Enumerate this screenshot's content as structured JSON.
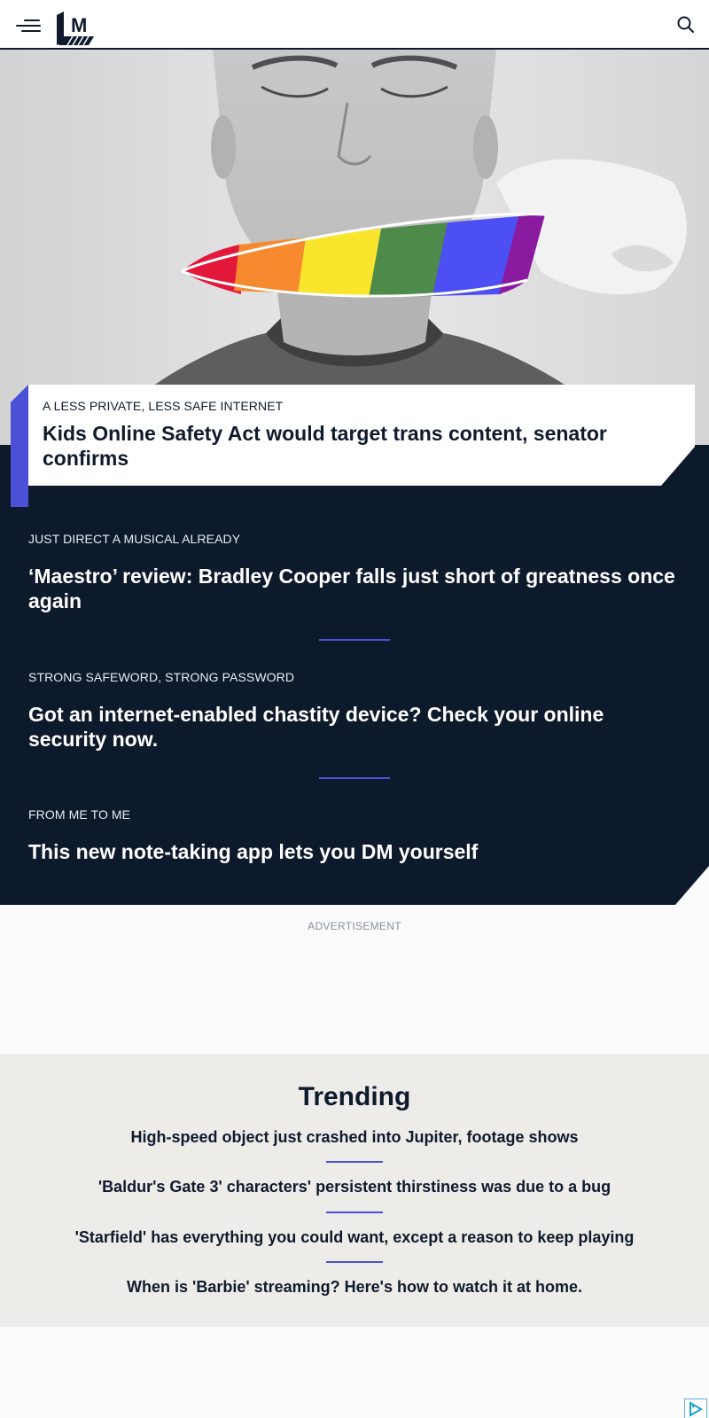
{
  "header": {
    "menu_icon": "hamburger-menu-icon",
    "logo_letter": "M",
    "search_icon": "search-icon"
  },
  "hero": {
    "image_alt": "Illustration of a young man with closed eyes; a torn rainbow paper strip covers his mouth",
    "kicker": "A LESS PRIVATE, LESS SAFE INTERNET",
    "title": "Kids Online Safety Act would target trans content, senator confirms"
  },
  "stories": [
    {
      "kicker": "JUST DIRECT A MUSICAL ALREADY",
      "title": "‘Maestro’ review: Bradley Cooper falls just short of greatness once again"
    },
    {
      "kicker": "STRONG SAFEWORD, STRONG PASSWORD",
      "title": "Got an internet-enabled chastity device? Check your online security now."
    },
    {
      "kicker": "FROM ME TO ME",
      "title": "This new note-taking app lets you DM yourself"
    }
  ],
  "advertisement_label": "ADVERTISEMENT",
  "trending": {
    "title": "Trending",
    "items": [
      "High-speed object just crashed into Jupiter, footage shows",
      "'Baldur's Gate 3' characters' persistent thirstiness was due to a bug",
      "'Starfield' has everything you could want, except a reason to keep playing",
      "When is 'Barbie' streaming? Here's how to watch it at home."
    ]
  },
  "colors": {
    "navy": "#0d1a2c",
    "accent": "#4c50d6",
    "trending_bg": "#eeece9"
  }
}
